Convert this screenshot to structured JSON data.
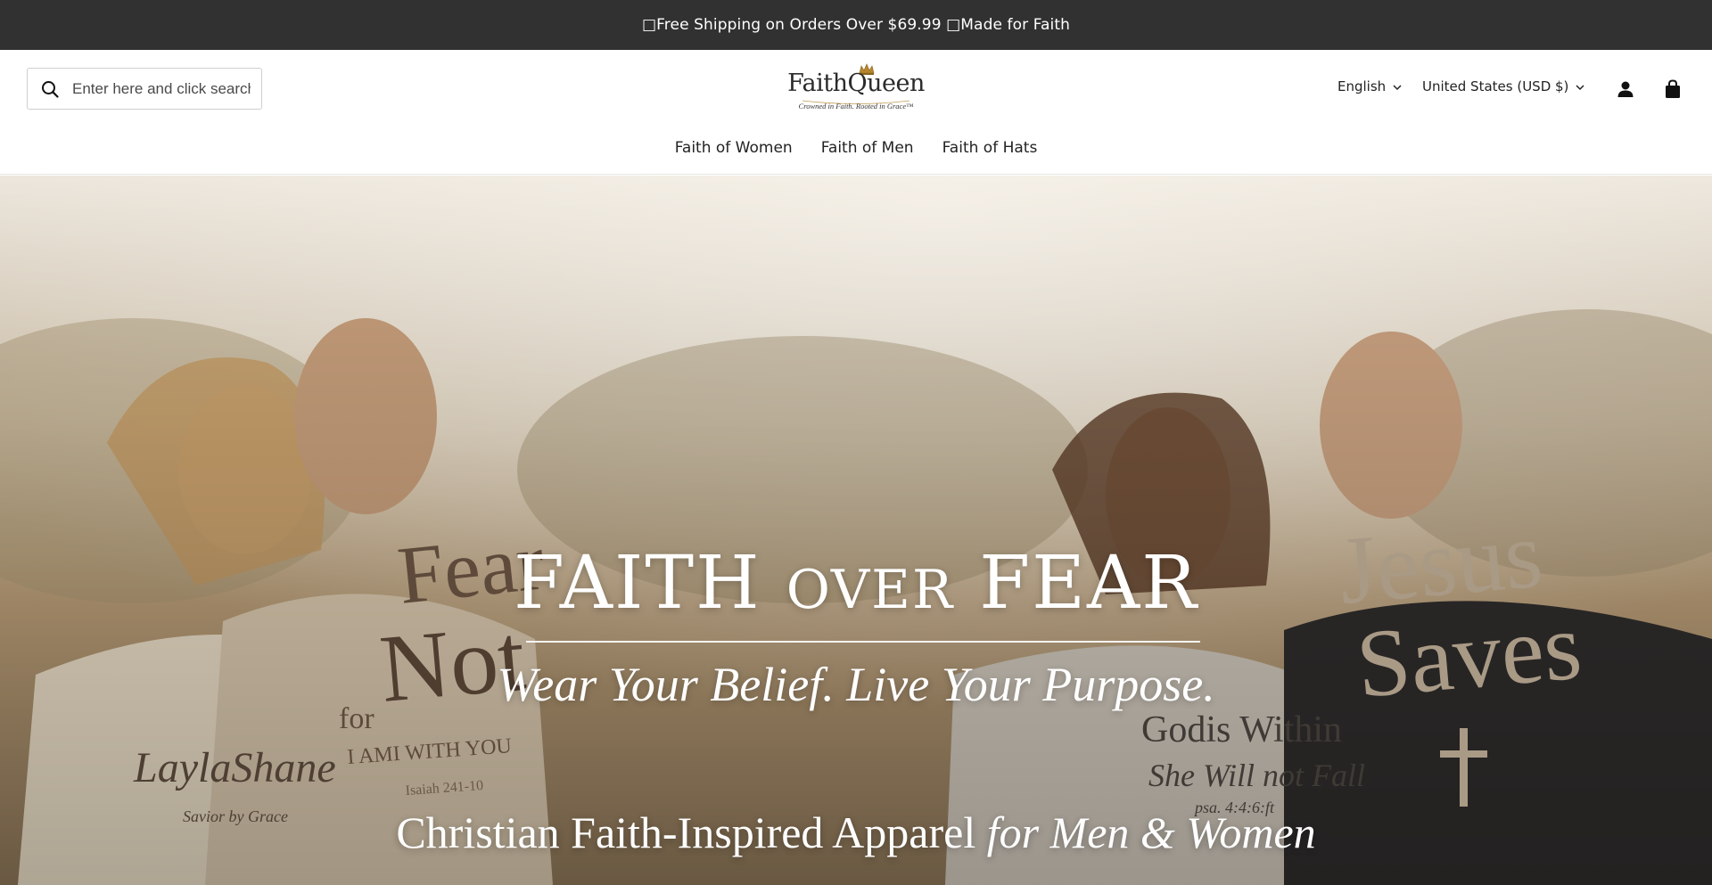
{
  "announcement": {
    "text": "□Free Shipping on Orders Over $69.99 □Made for Faith"
  },
  "header": {
    "search": {
      "placeholder": "Enter here and click search",
      "icon": "search-icon"
    },
    "logo": {
      "title": "FaithQueen",
      "tagline": "Crowned in Faith. Rooted in Grace™"
    },
    "language": {
      "selected": "English",
      "icon": "chevron-down-icon"
    },
    "country": {
      "selected": "United States (USD $)",
      "icon": "chevron-down-icon"
    },
    "account_icon": "account-icon",
    "cart_icon": "cart-icon"
  },
  "nav": {
    "items": [
      {
        "label": "Faith of Women"
      },
      {
        "label": "Faith of Men"
      },
      {
        "label": "Faith of Hats"
      }
    ]
  },
  "hero": {
    "title_part1": "FAITH",
    "title_part2": "OVER",
    "title_part3": "FEAR",
    "subtitle": "Wear Your Belief. Live Your Purpose.",
    "bottom_part1": "Christian Faith-Inspired Apparel",
    "bottom_part2": "for Men & Women",
    "shirt_texts": {
      "fear_not_1": "Fear",
      "fear_not_2": "Not",
      "fear_not_3": "for",
      "fear_not_4": "I AMI WITH YOU",
      "fear_not_5": "Isaiah 241-10",
      "layla_1": "LaylaShane",
      "layla_2": "Savior by Grace",
      "god_1": "Godis Within",
      "god_2": "She Will not Fall",
      "god_3": "psa. 4:4:6:ft",
      "jesus_1": "Jesus",
      "jesus_2": "Saves"
    }
  },
  "colors": {
    "announcement_bg": "#313131",
    "header_bg": "#ffffff",
    "text": "#222222"
  }
}
